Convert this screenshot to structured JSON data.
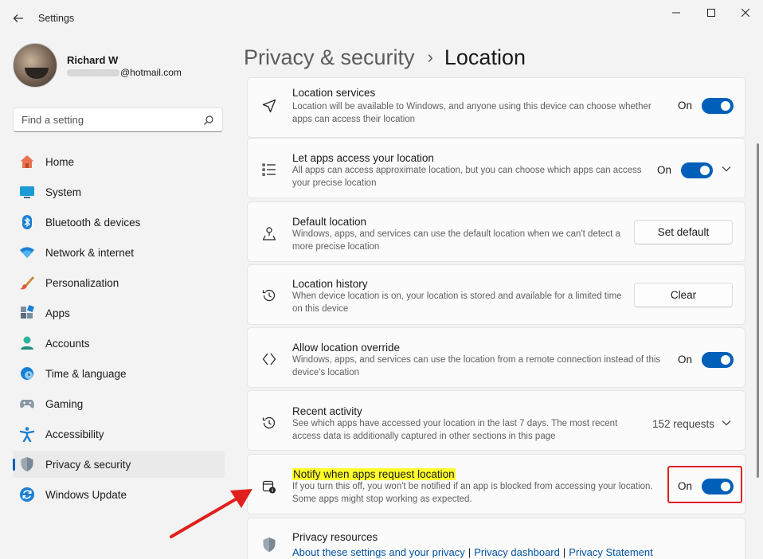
{
  "window": {
    "app_title": "Settings",
    "back_icon": "back-arrow-icon",
    "minimize_icon": "minimize-icon",
    "maximize_icon": "maximize-icon",
    "close_icon": "close-icon"
  },
  "profile": {
    "name": "Richard W",
    "email_domain": "@hotmail.com"
  },
  "search": {
    "placeholder": "Find a setting"
  },
  "sidebar": {
    "items": [
      {
        "label": "Home",
        "icon": "home-icon"
      },
      {
        "label": "System",
        "icon": "system-icon"
      },
      {
        "label": "Bluetooth & devices",
        "icon": "bluetooth-icon"
      },
      {
        "label": "Network & internet",
        "icon": "network-icon"
      },
      {
        "label": "Personalization",
        "icon": "brush-icon"
      },
      {
        "label": "Apps",
        "icon": "apps-icon"
      },
      {
        "label": "Accounts",
        "icon": "accounts-icon"
      },
      {
        "label": "Time & language",
        "icon": "time-language-icon"
      },
      {
        "label": "Gaming",
        "icon": "gaming-icon"
      },
      {
        "label": "Accessibility",
        "icon": "accessibility-icon"
      },
      {
        "label": "Privacy & security",
        "icon": "shield-icon",
        "active": true
      },
      {
        "label": "Windows Update",
        "icon": "windows-update-icon"
      }
    ]
  },
  "breadcrumb": {
    "parent": "Privacy & security",
    "separator": "›",
    "current": "Location"
  },
  "cards": [
    {
      "title": "Location services",
      "desc": "Location will be available to Windows, and anyone using this device can choose whether apps can access their location",
      "state": "On",
      "icon": "location-arrow-icon"
    },
    {
      "title": "Let apps access your location",
      "desc": "All apps can access approximate location, but you can choose which apps can access your precise location",
      "state": "On",
      "icon": "list-icon"
    },
    {
      "title": "Default location",
      "desc": "Windows, apps, and services can use the default location when we can't detect a more precise location",
      "button": "Set default",
      "icon": "map-pin-icon"
    },
    {
      "title": "Location history",
      "desc": "When device location is on, your location is stored and available for a limited time on this device",
      "button": "Clear",
      "icon": "history-icon"
    },
    {
      "title": "Allow location override",
      "desc": "Windows, apps, and services can use the location from a remote connection instead of this device's location",
      "state": "On",
      "icon": "override-icon"
    },
    {
      "title": "Recent activity",
      "desc": "See which apps have accessed your location in the last 7 days. The most recent access data is additionally captured in other sections in this page",
      "value": "152 requests",
      "icon": "history-icon"
    },
    {
      "title": "Notify when apps request location",
      "desc": "If you turn this off, you won't be notified if an app is blocked from accessing your location. Some apps might stop working as expected.",
      "state": "On",
      "icon": "notify-icon"
    },
    {
      "title": "Privacy resources",
      "icon": "shield-icon",
      "links": [
        "About these settings and your privacy",
        "Privacy dashboard",
        "Privacy Statement"
      ]
    }
  ],
  "colors": {
    "accent": "#005fb8",
    "highlight": "#ffff2b",
    "annotation_red": "#e0201d",
    "link": "#0352a3"
  }
}
